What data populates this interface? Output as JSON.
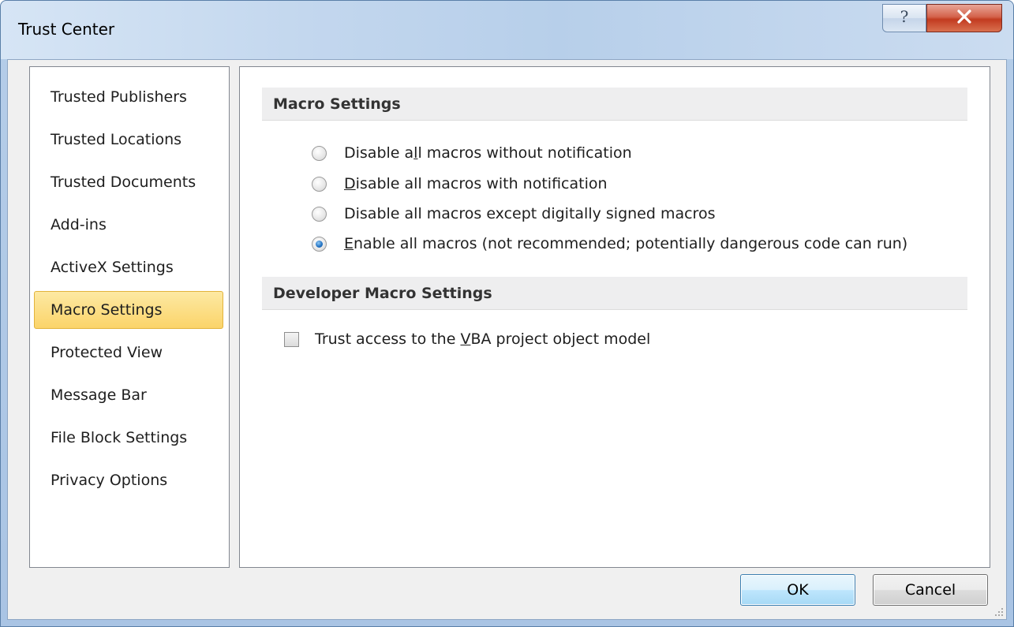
{
  "window": {
    "title": "Trust Center"
  },
  "nav": {
    "items": [
      {
        "label": "Trusted Publishers",
        "selected": false
      },
      {
        "label": "Trusted Locations",
        "selected": false
      },
      {
        "label": "Trusted Documents",
        "selected": false
      },
      {
        "label": "Add-ins",
        "selected": false
      },
      {
        "label": "ActiveX Settings",
        "selected": false
      },
      {
        "label": "Macro Settings",
        "selected": true
      },
      {
        "label": "Protected View",
        "selected": false
      },
      {
        "label": "Message Bar",
        "selected": false
      },
      {
        "label": "File Block Settings",
        "selected": false
      },
      {
        "label": "Privacy Options",
        "selected": false
      }
    ]
  },
  "macro_settings": {
    "header": "Macro Settings",
    "options": [
      {
        "pre": "Disable a",
        "access": "l",
        "post": "l macros without notification",
        "checked": false
      },
      {
        "pre": "",
        "access": "D",
        "post": "isable all macros with notification",
        "checked": false
      },
      {
        "pre": "Disable all macros except di",
        "access": "g",
        "post": "itally signed macros",
        "checked": false
      },
      {
        "pre": "",
        "access": "E",
        "post": "nable all macros (not recommended; potentially dangerous code can run)",
        "checked": true
      }
    ]
  },
  "developer_settings": {
    "header": "Developer Macro Settings",
    "checkbox": {
      "pre": "Trust access to the ",
      "access": "V",
      "post": "BA project object model",
      "checked": false
    }
  },
  "buttons": {
    "ok": "OK",
    "cancel": "Cancel"
  },
  "colors": {
    "selected_nav_bg": "#fbd46a",
    "radio_checked": "#1f6fc0",
    "close_button": "#c23b20"
  }
}
